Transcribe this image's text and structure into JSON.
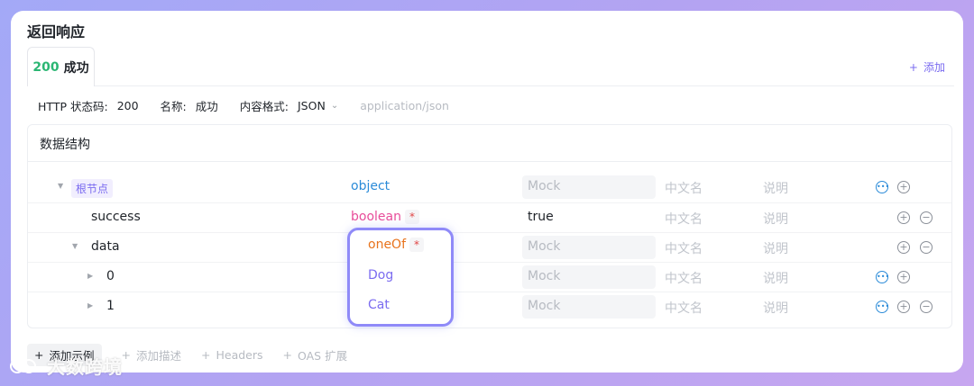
{
  "section_title": "返回响应",
  "tab": {
    "code": "200",
    "label": "成功"
  },
  "add_label": "添加",
  "meta": {
    "status_label": "HTTP 状态码:",
    "status_value": "200",
    "name_label": "名称:",
    "name_value": "成功",
    "format_label": "内容格式:",
    "format_value": "JSON",
    "mime": "application/json"
  },
  "schema": {
    "title": "数据结构",
    "rows": [
      {
        "name": "根节点",
        "type": "object",
        "mock_placeholder": "Mock",
        "cn": "中文名",
        "desc": "说明"
      },
      {
        "name": "success",
        "type": "boolean",
        "required": "*",
        "mock_value": "true",
        "cn": "中文名",
        "desc": "说明"
      },
      {
        "name": "data",
        "type": "oneOf",
        "required": "*",
        "mock_placeholder": "Mock",
        "cn": "中文名",
        "desc": "说明"
      },
      {
        "name": "0",
        "type": "Dog",
        "mock_placeholder": "Mock",
        "cn": "中文名",
        "desc": "说明"
      },
      {
        "name": "1",
        "type": "Cat",
        "mock_placeholder": "Mock",
        "cn": "中文名",
        "desc": "说明"
      }
    ]
  },
  "bottom_actions": [
    "添加示例",
    "添加描述",
    "Headers",
    "OAS 扩展"
  ],
  "watermark": "大数跨境",
  "colors": {
    "accent": "#7b6cf0",
    "success": "#2bb673",
    "object": "#2b8bd8",
    "boolean": "#e84d9a",
    "oneof": "#e8731c"
  },
  "icons": [
    "chevron-down-icon",
    "caret-right-icon",
    "more-circle-icon",
    "plus-circle-icon",
    "minus-circle-icon",
    "plus-icon"
  ]
}
